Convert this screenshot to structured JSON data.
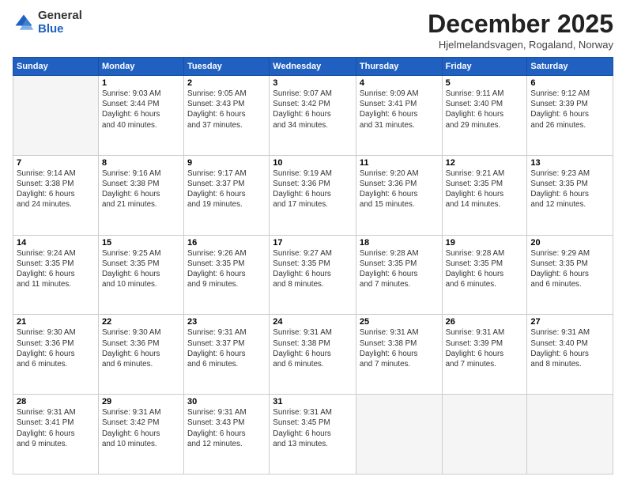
{
  "logo": {
    "general": "General",
    "blue": "Blue"
  },
  "header": {
    "month": "December 2025",
    "location": "Hjelmelandsvagen, Rogaland, Norway"
  },
  "weekdays": [
    "Sunday",
    "Monday",
    "Tuesday",
    "Wednesday",
    "Thursday",
    "Friday",
    "Saturday"
  ],
  "weeks": [
    [
      {
        "day": "",
        "info": ""
      },
      {
        "day": "1",
        "info": "Sunrise: 9:03 AM\nSunset: 3:44 PM\nDaylight: 6 hours\nand 40 minutes."
      },
      {
        "day": "2",
        "info": "Sunrise: 9:05 AM\nSunset: 3:43 PM\nDaylight: 6 hours\nand 37 minutes."
      },
      {
        "day": "3",
        "info": "Sunrise: 9:07 AM\nSunset: 3:42 PM\nDaylight: 6 hours\nand 34 minutes."
      },
      {
        "day": "4",
        "info": "Sunrise: 9:09 AM\nSunset: 3:41 PM\nDaylight: 6 hours\nand 31 minutes."
      },
      {
        "day": "5",
        "info": "Sunrise: 9:11 AM\nSunset: 3:40 PM\nDaylight: 6 hours\nand 29 minutes."
      },
      {
        "day": "6",
        "info": "Sunrise: 9:12 AM\nSunset: 3:39 PM\nDaylight: 6 hours\nand 26 minutes."
      }
    ],
    [
      {
        "day": "7",
        "info": "Sunrise: 9:14 AM\nSunset: 3:38 PM\nDaylight: 6 hours\nand 24 minutes."
      },
      {
        "day": "8",
        "info": "Sunrise: 9:16 AM\nSunset: 3:38 PM\nDaylight: 6 hours\nand 21 minutes."
      },
      {
        "day": "9",
        "info": "Sunrise: 9:17 AM\nSunset: 3:37 PM\nDaylight: 6 hours\nand 19 minutes."
      },
      {
        "day": "10",
        "info": "Sunrise: 9:19 AM\nSunset: 3:36 PM\nDaylight: 6 hours\nand 17 minutes."
      },
      {
        "day": "11",
        "info": "Sunrise: 9:20 AM\nSunset: 3:36 PM\nDaylight: 6 hours\nand 15 minutes."
      },
      {
        "day": "12",
        "info": "Sunrise: 9:21 AM\nSunset: 3:35 PM\nDaylight: 6 hours\nand 14 minutes."
      },
      {
        "day": "13",
        "info": "Sunrise: 9:23 AM\nSunset: 3:35 PM\nDaylight: 6 hours\nand 12 minutes."
      }
    ],
    [
      {
        "day": "14",
        "info": "Sunrise: 9:24 AM\nSunset: 3:35 PM\nDaylight: 6 hours\nand 11 minutes."
      },
      {
        "day": "15",
        "info": "Sunrise: 9:25 AM\nSunset: 3:35 PM\nDaylight: 6 hours\nand 10 minutes."
      },
      {
        "day": "16",
        "info": "Sunrise: 9:26 AM\nSunset: 3:35 PM\nDaylight: 6 hours\nand 9 minutes."
      },
      {
        "day": "17",
        "info": "Sunrise: 9:27 AM\nSunset: 3:35 PM\nDaylight: 6 hours\nand 8 minutes."
      },
      {
        "day": "18",
        "info": "Sunrise: 9:28 AM\nSunset: 3:35 PM\nDaylight: 6 hours\nand 7 minutes."
      },
      {
        "day": "19",
        "info": "Sunrise: 9:28 AM\nSunset: 3:35 PM\nDaylight: 6 hours\nand 6 minutes."
      },
      {
        "day": "20",
        "info": "Sunrise: 9:29 AM\nSunset: 3:35 PM\nDaylight: 6 hours\nand 6 minutes."
      }
    ],
    [
      {
        "day": "21",
        "info": "Sunrise: 9:30 AM\nSunset: 3:36 PM\nDaylight: 6 hours\nand 6 minutes."
      },
      {
        "day": "22",
        "info": "Sunrise: 9:30 AM\nSunset: 3:36 PM\nDaylight: 6 hours\nand 6 minutes."
      },
      {
        "day": "23",
        "info": "Sunrise: 9:31 AM\nSunset: 3:37 PM\nDaylight: 6 hours\nand 6 minutes."
      },
      {
        "day": "24",
        "info": "Sunrise: 9:31 AM\nSunset: 3:38 PM\nDaylight: 6 hours\nand 6 minutes."
      },
      {
        "day": "25",
        "info": "Sunrise: 9:31 AM\nSunset: 3:38 PM\nDaylight: 6 hours\nand 7 minutes."
      },
      {
        "day": "26",
        "info": "Sunrise: 9:31 AM\nSunset: 3:39 PM\nDaylight: 6 hours\nand 7 minutes."
      },
      {
        "day": "27",
        "info": "Sunrise: 9:31 AM\nSunset: 3:40 PM\nDaylight: 6 hours\nand 8 minutes."
      }
    ],
    [
      {
        "day": "28",
        "info": "Sunrise: 9:31 AM\nSunset: 3:41 PM\nDaylight: 6 hours\nand 9 minutes."
      },
      {
        "day": "29",
        "info": "Sunrise: 9:31 AM\nSunset: 3:42 PM\nDaylight: 6 hours\nand 10 minutes."
      },
      {
        "day": "30",
        "info": "Sunrise: 9:31 AM\nSunset: 3:43 PM\nDaylight: 6 hours\nand 12 minutes."
      },
      {
        "day": "31",
        "info": "Sunrise: 9:31 AM\nSunset: 3:45 PM\nDaylight: 6 hours\nand 13 minutes."
      },
      {
        "day": "",
        "info": ""
      },
      {
        "day": "",
        "info": ""
      },
      {
        "day": "",
        "info": ""
      }
    ]
  ]
}
